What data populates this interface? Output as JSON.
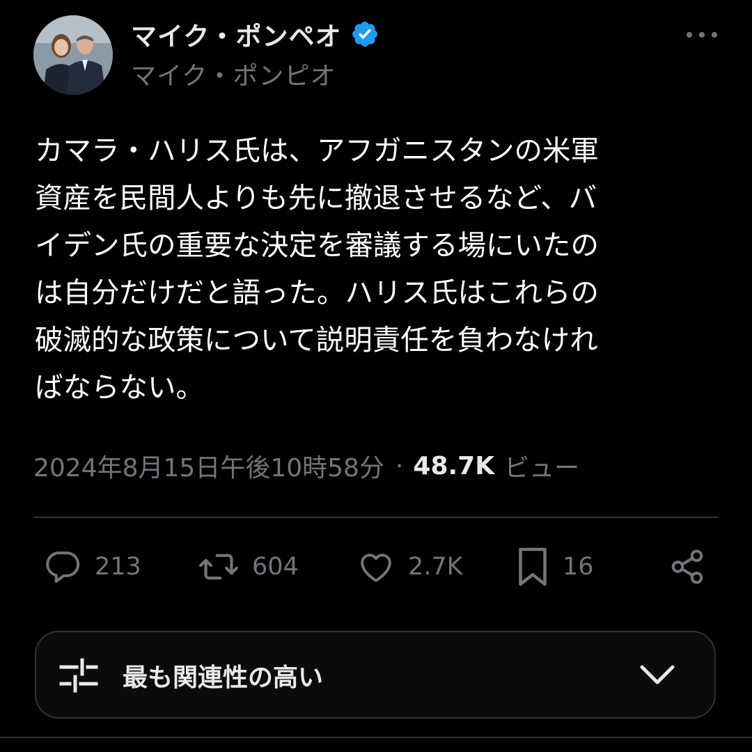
{
  "author": {
    "display_name": "マイク・ポンペオ",
    "handle": "マイク・ポンピオ",
    "verified_color": "#1d9bf0"
  },
  "tweet": {
    "text": "カマラ・ハリス氏は、アフガニスタンの米軍\n資産を民間人よりも先に撤退させるなど、バ\nイデン氏の重要な決定を審議する場にいたの\nは自分だけだと語った。ハリス氏はこれらの\n破滅的な政策について説明責任を負わなけれ\nばならない。",
    "timestamp": "2024年8月15日午後10時58分",
    "separator": "·",
    "views_count": "48.7K",
    "views_label": "ビュー"
  },
  "actions": {
    "reply_count": "213",
    "retweet_count": "604",
    "like_count": "2.7K",
    "bookmark_count": "16"
  },
  "sort": {
    "label": "最も関連性の高い"
  },
  "colors": {
    "background": "#000000",
    "text_primary": "#e7e9ea",
    "text_secondary": "#71767b",
    "divider": "#2f3336",
    "verified": "#1d9bf0"
  },
  "icons": [
    "verified-badge-icon",
    "more-icon",
    "reply-icon",
    "retweet-icon",
    "like-icon",
    "bookmark-icon",
    "share-icon",
    "filter-icon",
    "chevron-down-icon"
  ]
}
